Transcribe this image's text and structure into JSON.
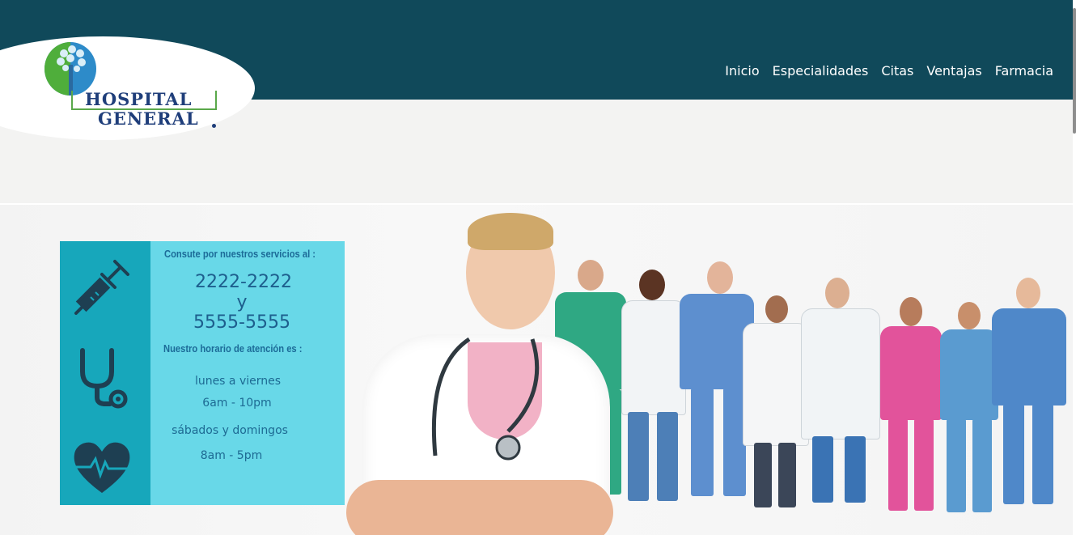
{
  "header": {
    "logo": {
      "line1": "HOSPITAL",
      "line2": "GENERAL"
    },
    "nav": [
      {
        "label": "Inicio"
      },
      {
        "label": "Especialidades"
      },
      {
        "label": "Citas"
      },
      {
        "label": "Ventajas"
      },
      {
        "label": "Farmacia"
      }
    ]
  },
  "banner": {
    "consult_heading": "Consute por nuestros servicios al :",
    "phone1": "2222-2222",
    "conjunction": "y",
    "phone2": "5555-5555",
    "hours_heading": "Nuestro horario de  atención es :",
    "weekday_label": "lunes a viernes",
    "weekday_hours": "6am - 10pm",
    "weekend_label": "sábados y domingos",
    "weekend_hours": "8am - 5pm",
    "icons": [
      "syringe-icon",
      "stethoscope-icon",
      "heart-pulse-icon"
    ]
  },
  "colors": {
    "topbar": "#10495a",
    "info_dark": "#17a7bb",
    "info_light": "#68d8e8",
    "text_blue": "#1d5e8d"
  }
}
